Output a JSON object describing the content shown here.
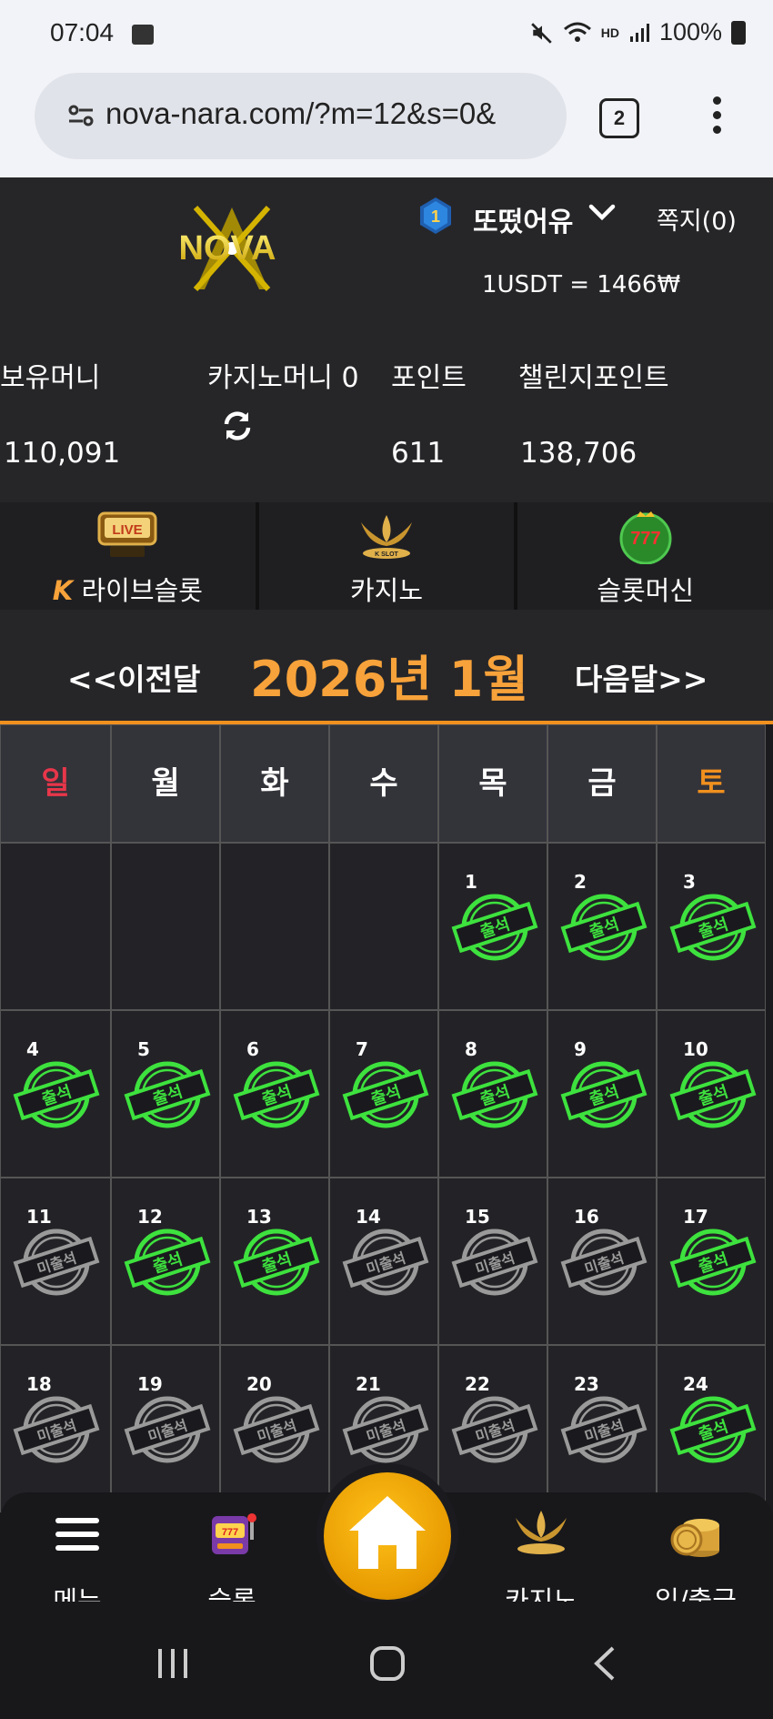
{
  "status_bar": {
    "time": "07:04",
    "battery": "100%",
    "hd_label": "HD"
  },
  "browser": {
    "url": "nova-nara.com/?m=12&s=0&",
    "tab_count": "2"
  },
  "header": {
    "logo_text": "NOVA",
    "level": "1",
    "username": "또떴어유",
    "messages": "쪽지(0)",
    "rate": "1USDT = 1466₩"
  },
  "wallet": {
    "money_label": "보유머니",
    "money_value": "110,091",
    "casino_label": "카지노머니 0",
    "point_label": "포인트",
    "point_value": "611",
    "challenge_label": "챌린지포인트",
    "challenge_value": "138,706"
  },
  "categories": [
    {
      "label": "라이브슬롯",
      "icon_text": "LIVE"
    },
    {
      "label": "카지노",
      "icon_text": "K SLOT"
    },
    {
      "label": "슬롯머신",
      "icon_text": "777"
    }
  ],
  "calendar": {
    "prev": "<<이전달",
    "title": "2026년 1월",
    "next": "다음달>>",
    "weekdays": [
      "일",
      "월",
      "화",
      "수",
      "목",
      "금",
      "토"
    ],
    "stamp_attended": "출석",
    "stamp_absent": "미출석",
    "weeks": [
      [
        null,
        null,
        null,
        null,
        {
          "day": "1",
          "attended": true
        },
        {
          "day": "2",
          "attended": true
        },
        {
          "day": "3",
          "attended": true
        }
      ],
      [
        {
          "day": "4",
          "attended": true
        },
        {
          "day": "5",
          "attended": true
        },
        {
          "day": "6",
          "attended": true
        },
        {
          "day": "7",
          "attended": true
        },
        {
          "day": "8",
          "attended": true
        },
        {
          "day": "9",
          "attended": true
        },
        {
          "day": "10",
          "attended": true
        }
      ],
      [
        {
          "day": "11",
          "attended": false
        },
        {
          "day": "12",
          "attended": true
        },
        {
          "day": "13",
          "attended": true
        },
        {
          "day": "14",
          "attended": false
        },
        {
          "day": "15",
          "attended": false
        },
        {
          "day": "16",
          "attended": false
        },
        {
          "day": "17",
          "attended": true
        }
      ],
      [
        {
          "day": "18",
          "attended": false
        },
        {
          "day": "19",
          "attended": false
        },
        {
          "day": "20",
          "attended": false
        },
        {
          "day": "21",
          "attended": false
        },
        {
          "day": "22",
          "attended": false
        },
        {
          "day": "23",
          "attended": false
        },
        {
          "day": "24",
          "attended": true
        }
      ]
    ]
  },
  "bottom_nav": [
    {
      "label": "메뉴"
    },
    {
      "label": "슬롯"
    },
    {
      "label": ""
    },
    {
      "label": "카지노"
    },
    {
      "label": "입/출금"
    }
  ],
  "colors": {
    "accent": "#f7a23a",
    "sunday": "#e8364a",
    "saturday": "#f0901e",
    "stamp_green": "#3ee23e",
    "stamp_gray": "#9a9a9a"
  }
}
